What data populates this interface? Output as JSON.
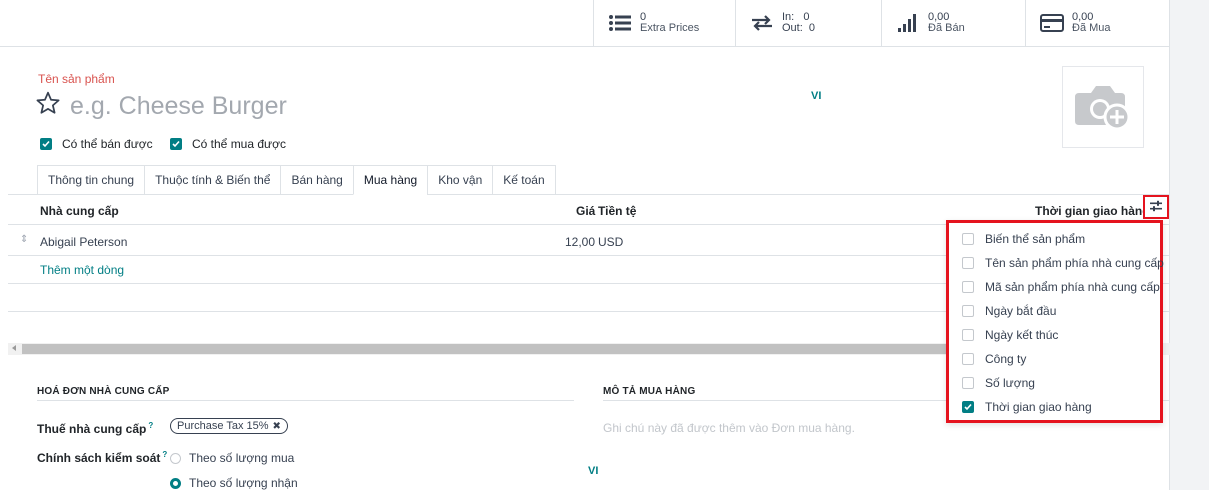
{
  "smart_buttons": {
    "extra_prices": {
      "count": "0",
      "label": "Extra Prices"
    },
    "in_out": {
      "in_label": "In:",
      "in_value": "0",
      "out_label": "Out:",
      "out_value": "0"
    },
    "sold": {
      "value": "0,00",
      "label": "Đã Bán"
    },
    "purchased": {
      "value": "0,00",
      "label": "Đã Mua"
    }
  },
  "product": {
    "name_label": "Tên sản phẩm",
    "name_placeholder": "e.g. Cheese Burger",
    "lang": "VI",
    "can_be_sold": "Có thể bán được",
    "can_be_purchased": "Có thể mua được"
  },
  "tabs": [
    "Thông tin chung",
    "Thuộc tính & Biến thể",
    "Bán hàng",
    "Mua hàng",
    "Kho vận",
    "Kế toán"
  ],
  "active_tab": "Mua hàng",
  "table": {
    "headers": {
      "vendor": "Nhà cung cấp",
      "price": "Giá",
      "currency": "Tiền tệ",
      "lead_time": "Thời gian giao hàng"
    },
    "rows": [
      {
        "vendor": "Abigail Peterson",
        "price": "12,00",
        "currency": "USD"
      }
    ],
    "add_line": "Thêm một dòng"
  },
  "optional_columns": [
    {
      "label": "Biến thể sản phẩm",
      "checked": false
    },
    {
      "label": "Tên sản phẩm phía nhà cung cấp",
      "checked": false
    },
    {
      "label": "Mã sản phẩm phía nhà cung cấp",
      "checked": false
    },
    {
      "label": "Ngày bắt đầu",
      "checked": false
    },
    {
      "label": "Ngày kết thúc",
      "checked": false
    },
    {
      "label": "Công ty",
      "checked": false
    },
    {
      "label": "Số lượng",
      "checked": false
    },
    {
      "label": "Thời gian giao hàng",
      "checked": true
    }
  ],
  "vendor_bills": {
    "title": "HOÁ ĐƠN NHÀ CUNG CẤP",
    "tax_label": "Thuế nhà cung cấp",
    "help": "?",
    "tax_value": "Purchase Tax 15%",
    "control_label": "Chính sách kiểm soát",
    "control_options": [
      "Theo số lượng mua",
      "Theo số lượng nhận"
    ],
    "control_selected": "Theo số lượng nhận"
  },
  "purchase_description": {
    "title": "MÔ TẢ MUA HÀNG",
    "placeholder": "Ghi chú này đã được thêm vào Đơn mua hàng.",
    "lang": "VI"
  },
  "colors": {
    "accent": "#017e84",
    "highlight": "#e5131e",
    "label_red": "#d9534f"
  }
}
